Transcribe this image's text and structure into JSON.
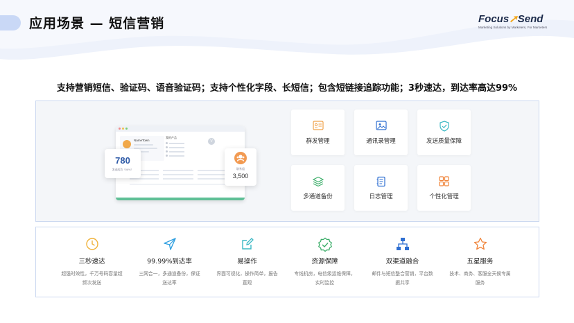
{
  "header": {
    "title": "应用场景 — 短信营销",
    "logo_name": "Focus",
    "logo_name_accent": "Send",
    "logo_tagline": "Marketing Solutions by Marketers, For Marketers"
  },
  "subtitle": "支持营销短信、验证码、语音验证码；支持个性化字段、长短信；包含短链接追踪功能；3秒速达，到达率高达99%",
  "mockup": {
    "profile_name": "NameTown",
    "list_title": "我的产品",
    "avatar_initial": "V",
    "stat1_value": "780",
    "stat1_label": "发送成功（96%）",
    "stat2_label": "联系组",
    "stat2_value": "3,500"
  },
  "features": [
    {
      "label": "群发管理",
      "icon": "group-send-icon"
    },
    {
      "label": "通讯录管理",
      "icon": "contacts-icon"
    },
    {
      "label": "发送质量保障",
      "icon": "shield-check-icon"
    },
    {
      "label": "多通道备份",
      "icon": "layers-icon"
    },
    {
      "label": "日志管理",
      "icon": "log-icon"
    },
    {
      "label": "个性化管理",
      "icon": "grid-icon"
    }
  ],
  "advantages": [
    {
      "title": "三秒速达",
      "desc": "超强时效性，千万号码容量超频次发送",
      "icon": "clock-icon"
    },
    {
      "title": "99.99%到达率",
      "desc": "三网合一，多通道备份，保证送达率",
      "icon": "send-arrow-icon"
    },
    {
      "title": "易操作",
      "desc": "界面可视化，操作简单，报告直观",
      "icon": "edit-icon"
    },
    {
      "title": "资源保障",
      "desc": "专线机房，电信级运维保障，实时监控",
      "icon": "badge-check-icon"
    },
    {
      "title": "双渠道融合",
      "desc": "邮件与短信整合营销，平台数据共享",
      "icon": "network-icon"
    },
    {
      "title": "五星服务",
      "desc": "技术、商务、客服全天候专属服务",
      "icon": "star-icon"
    }
  ],
  "colors": {
    "feature_icon": "#f0a24a",
    "advantage_icon": "#2f6fd1",
    "wave": "#e8eefb",
    "accent_green": "#5fbf96"
  }
}
